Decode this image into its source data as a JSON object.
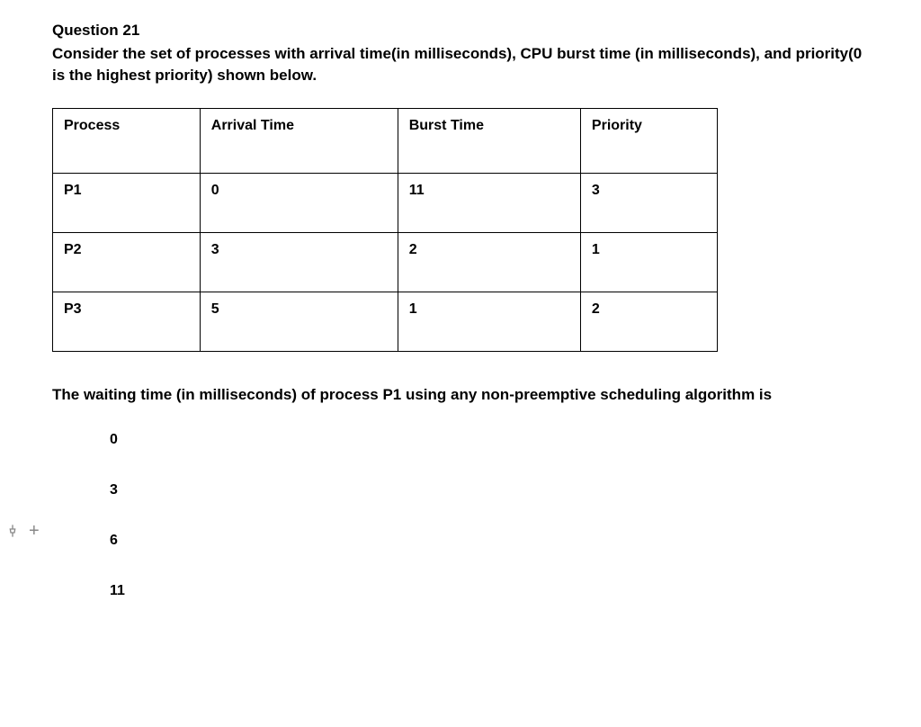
{
  "question": {
    "title": "Question 21",
    "intro": "Consider the set of processes with arrival time(in milliseconds), CPU burst time (in milliseconds), and priority(0 is the highest priority) shown below.",
    "followup": "The waiting time (in milliseconds) of process P1 using any non-preemptive scheduling algorithm is"
  },
  "table": {
    "headers": {
      "c0": "Process",
      "c1": "Arrival Time",
      "c2": "Burst Time",
      "c3": "Priority"
    },
    "rows": [
      {
        "c0": "P1",
        "c1": "0",
        "c2": "11",
        "c3": "3"
      },
      {
        "c0": "P2",
        "c1": "3",
        "c2": "2",
        "c3": "1"
      },
      {
        "c0": "P3",
        "c1": "5",
        "c2": "1",
        "c3": "2"
      }
    ]
  },
  "answers": {
    "a0": "0",
    "a1": "3",
    "a2": "6",
    "a3": "11"
  },
  "side": {
    "pin": "pin-icon",
    "plus": "+"
  }
}
